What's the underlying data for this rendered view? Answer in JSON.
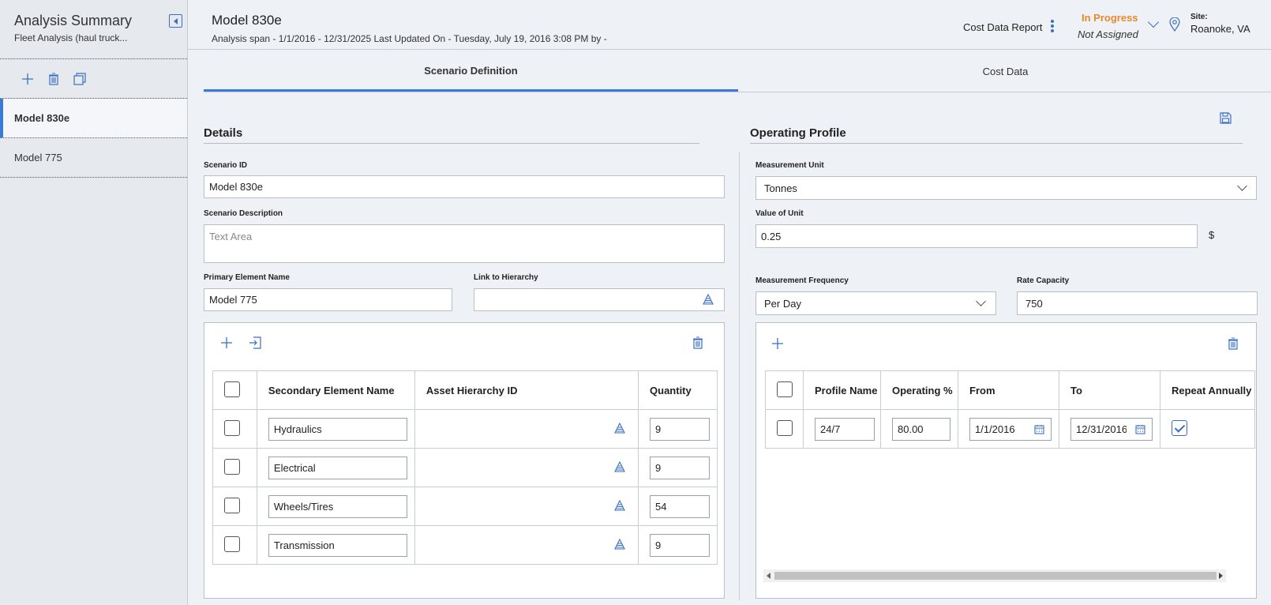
{
  "sidebar": {
    "title": "Analysis Summary",
    "subtitle": "Fleet Analysis (haul truck...",
    "items": [
      {
        "label": "Model 830e",
        "active": true
      },
      {
        "label": "Model 775",
        "active": false
      }
    ]
  },
  "header": {
    "title": "Model 830e",
    "subtitle": "Analysis span - 1/1/2016 - 12/31/2025 Last Updated On - Tuesday, July 19, 2016 3:08 PM by -",
    "report_label": "Cost Data Report",
    "status": "In Progress",
    "assigned": "Not Assigned",
    "site_label": "Site:",
    "site": "Roanoke, VA"
  },
  "tabs": [
    {
      "label": "Scenario Definition",
      "active": true
    },
    {
      "label": "Cost Data",
      "active": false
    }
  ],
  "details": {
    "title": "Details",
    "scenario_id_label": "Scenario ID",
    "scenario_id": "Model 830e",
    "description_label": "Scenario Description",
    "description_placeholder": "Text Area",
    "primary_label": "Primary Element Name",
    "primary_value": "Model 775",
    "link_label": "Link to Hierarchy",
    "link_value": "",
    "table": {
      "headers": [
        "Secondary Element Name",
        "Asset Hierarchy ID",
        "Quantity"
      ],
      "rows": [
        {
          "name": "Hydraulics",
          "hierarchy": "",
          "quantity": "9"
        },
        {
          "name": "Electrical",
          "hierarchy": "",
          "quantity": "9"
        },
        {
          "name": "Wheels/Tires",
          "hierarchy": "",
          "quantity": "54"
        },
        {
          "name": "Transmission",
          "hierarchy": "",
          "quantity": "9"
        }
      ]
    }
  },
  "operating": {
    "title": "Operating Profile",
    "unit_label": "Measurement Unit",
    "unit_value": "Tonnes",
    "value_label": "Value of Unit",
    "value": "0.25",
    "currency": "$",
    "freq_label": "Measurement Frequency",
    "freq_value": "Per Day",
    "rate_label": "Rate Capacity",
    "rate_value": "750",
    "table": {
      "headers": [
        "Profile Name",
        "Operating %",
        "From",
        "To",
        "Repeat Annually"
      ],
      "rows": [
        {
          "name": "24/7",
          "operating": "80.00",
          "from": "1/1/2016",
          "to": "12/31/2016",
          "repeat": true
        }
      ]
    }
  },
  "colors": {
    "accent": "#3a7bd5",
    "status": "#e8892b"
  }
}
